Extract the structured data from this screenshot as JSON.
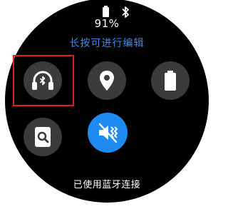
{
  "status": {
    "battery_percent": "91%",
    "battery_icon": "battery-icon",
    "bluetooth_icon": "bluetooth-icon"
  },
  "hint_text": "长按可进行编辑",
  "tiles": [
    {
      "icon": "bluetooth-headphones-icon",
      "state": "off"
    },
    {
      "icon": "location-pin-icon",
      "state": "off"
    },
    {
      "icon": "battery-saver-icon",
      "state": "off"
    },
    {
      "icon": "find-device-icon",
      "state": "off"
    },
    {
      "icon": "mute-vibrate-icon",
      "state": "on"
    }
  ],
  "connection_status": "已使用蓝牙连接",
  "colors": {
    "accent": "#1f8af2",
    "hint": "#3a8cf5",
    "tile_bg": "#3b3b3b",
    "highlight": "#e02020"
  }
}
